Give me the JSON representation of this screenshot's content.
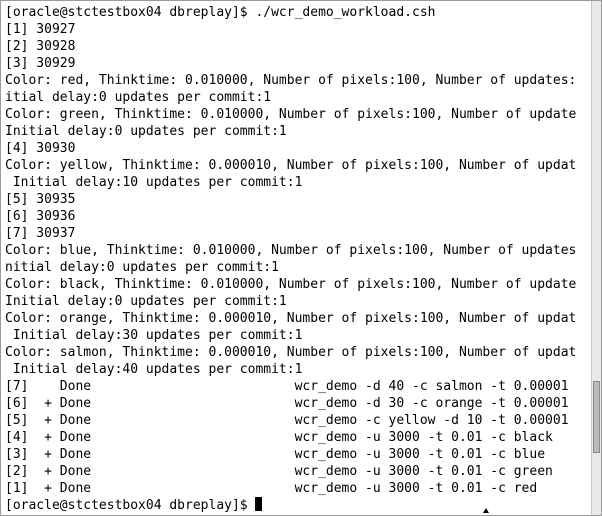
{
  "terminal": {
    "lines": [
      "[oracle@stctestbox04 dbreplay]$ ./wcr_demo_workload.csh",
      "[1] 30927",
      "[2] 30928",
      "[3] 30929",
      "Color: red, Thinktime: 0.010000, Number of pixels:100, Number of updates:",
      "itial delay:0 updates per commit:1",
      "Color: green, Thinktime: 0.010000, Number of pixels:100, Number of update",
      "Initial delay:0 updates per commit:1",
      "[4] 30930",
      "Color: yellow, Thinktime: 0.000010, Number of pixels:100, Number of updat",
      " Initial delay:10 updates per commit:1",
      "[5] 30935",
      "[6] 30936",
      "[7] 30937",
      "Color: blue, Thinktime: 0.010000, Number of pixels:100, Number of updates",
      "nitial delay:0 updates per commit:1",
      "Color: black, Thinktime: 0.010000, Number of pixels:100, Number of update",
      "Initial delay:0 updates per commit:1",
      "Color: orange, Thinktime: 0.000010, Number of pixels:100, Number of updat",
      " Initial delay:30 updates per commit:1",
      "Color: salmon, Thinktime: 0.000010, Number of pixels:100, Number of updat",
      " Initial delay:40 updates per commit:1",
      "[7]    Done                          wcr_demo -d 40 -c salmon -t 0.00001",
      "[6]  + Done                          wcr_demo -d 30 -c orange -t 0.00001",
      "[5]  + Done                          wcr_demo -c yellow -d 10 -t 0.00001",
      "[4]  + Done                          wcr_demo -u 3000 -t 0.01 -c black",
      "[3]  + Done                          wcr_demo -u 3000 -t 0.01 -c blue",
      "[2]  + Done                          wcr_demo -u 3000 -t 0.01 -c green",
      "[1]  + Done                          wcr_demo -u 3000 -t 0.01 -c red",
      "[oracle@stctestbox04 dbreplay]$ "
    ]
  },
  "scrollbar": {
    "position_fraction": 0.86
  }
}
